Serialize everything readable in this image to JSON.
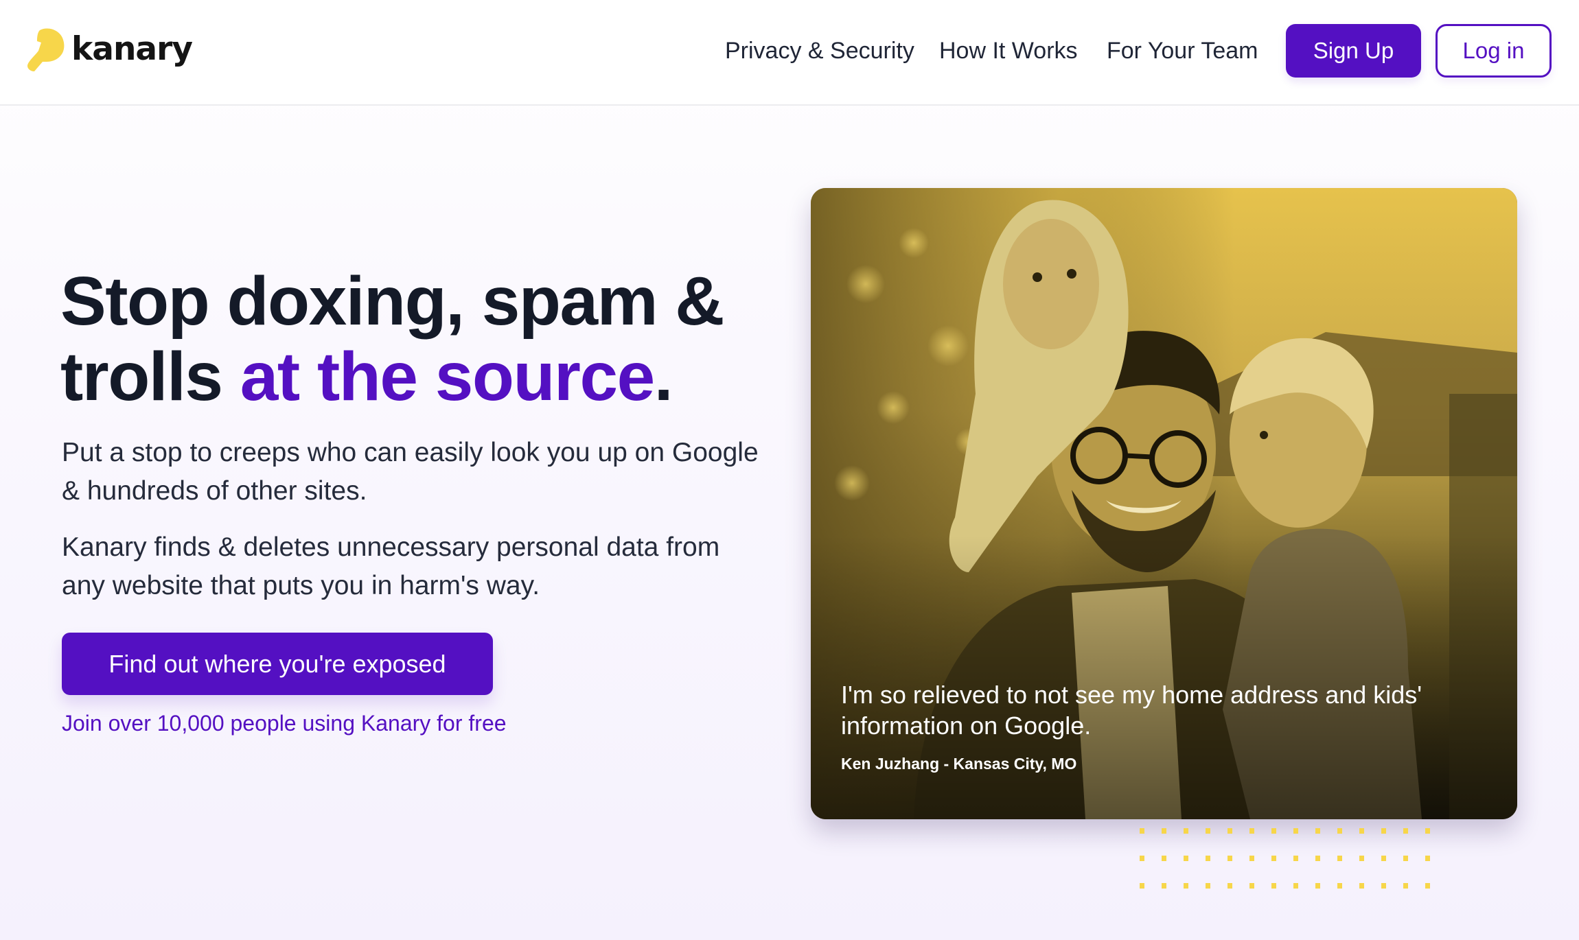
{
  "brand": {
    "name": "kanary",
    "logo_icon": "canary-bird-icon",
    "accent_color": "#5410c2",
    "brand_yellow": "#f7d64a",
    "text_dark": "#141a28"
  },
  "nav": {
    "links": [
      {
        "label": "Privacy & Security"
      },
      {
        "label": "How It Works"
      },
      {
        "label": "For Your Team"
      }
    ],
    "signup_label": "Sign Up",
    "login_label": "Log in"
  },
  "hero": {
    "headline_part1": "Stop doxing, spam & trolls ",
    "headline_accent": "at the source",
    "headline_end": ".",
    "paragraph_1": "Put a stop to creeps who can easily look you up on Google & hundreds of other sites.",
    "paragraph_2": "Kanary finds & deletes unnecessary personal data from any website that puts you in harm's way.",
    "cta_label": "Find out where you're exposed",
    "social_proof": "Join over 10,000 people using Kanary for free"
  },
  "testimonial": {
    "photo_description": "Father with glasses carrying a toddler on his shoulders and holding a young child, yellow duotone",
    "quote": "I'm so relieved to not see my home address and kids' information on Google.",
    "author": "Ken Juzhang - Kansas City, MO"
  },
  "decoration": {
    "dot_grid_columns": 14,
    "dot_grid_rows": 3,
    "dot_color": "#f7d64a"
  }
}
